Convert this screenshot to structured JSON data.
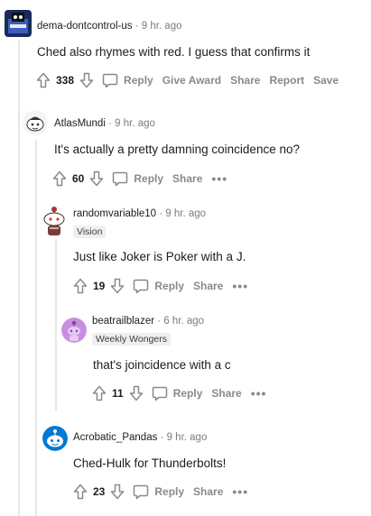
{
  "comments": [
    {
      "username": "dema-dontcontrol-us",
      "separator": "·",
      "time": "9 hr. ago",
      "body": "Ched also rhymes with red. I guess that confirms it",
      "score": "338",
      "actions": {
        "reply": "Reply",
        "award": "Give Award",
        "share": "Share",
        "report": "Report",
        "save": "Save"
      }
    },
    {
      "username": "AtlasMundi",
      "separator": "·",
      "time": "9 hr. ago",
      "body": "It's actually a pretty damning coincidence no?",
      "score": "60",
      "actions": {
        "reply": "Reply",
        "share": "Share",
        "more": "•••"
      }
    },
    {
      "username": "randomvariable10",
      "separator": "·",
      "time": "9 hr. ago",
      "flair": "Vision",
      "body": "Just like Joker is Poker with a J.",
      "score": "19",
      "actions": {
        "reply": "Reply",
        "share": "Share",
        "more": "•••"
      }
    },
    {
      "username": "beatrailblazer",
      "separator": "·",
      "time": "6 hr. ago",
      "flair": "Weekly Wongers",
      "body": "that's joincidence with a c",
      "score": "11",
      "actions": {
        "reply": "Reply",
        "share": "Share",
        "more": "•••"
      }
    },
    {
      "username": "Acrobatic_Pandas",
      "separator": "·",
      "time": "9 hr. ago",
      "body": "Ched-Hulk for Thunderbolts!",
      "score": "23",
      "actions": {
        "reply": "Reply",
        "share": "Share",
        "more": "•••"
      }
    }
  ],
  "icons": {
    "upvote": "upvote-icon",
    "downvote": "downvote-icon",
    "reply": "comment-bubble-icon"
  },
  "colors": {
    "action_gray": "#878a8c",
    "time_gray": "#7c7c7c",
    "flair_bg": "#edeff1",
    "thread_line": "#e4e6e8"
  }
}
